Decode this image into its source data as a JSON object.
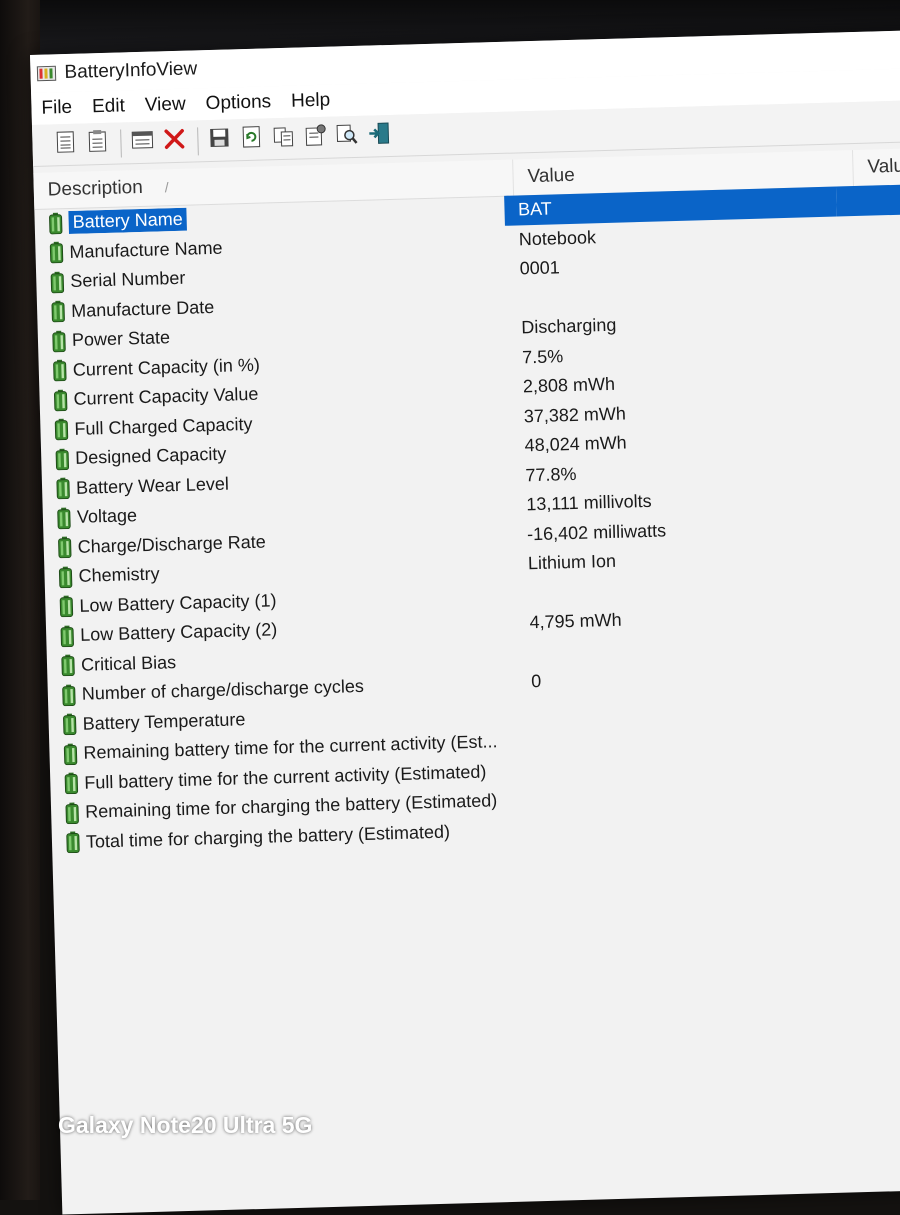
{
  "window": {
    "title": "BatteryInfoView",
    "app_icon": "battery-app-icon"
  },
  "menu": [
    "File",
    "Edit",
    "View",
    "Options",
    "Help"
  ],
  "toolbar": [
    {
      "icon": "html-report-icon"
    },
    {
      "icon": "report-icon"
    },
    {
      "sep": true
    },
    {
      "icon": "properties-icon"
    },
    {
      "icon": "delete-icon"
    },
    {
      "sep": true
    },
    {
      "icon": "save-icon"
    },
    {
      "icon": "refresh-icon"
    },
    {
      "icon": "copy-icon"
    },
    {
      "icon": "options-icon"
    },
    {
      "icon": "find-icon"
    },
    {
      "icon": "exit-icon"
    }
  ],
  "columns": {
    "description": "Description",
    "value": "Value",
    "value2": "Valu"
  },
  "rows": [
    {
      "description": "Battery Name",
      "value": "BAT",
      "selected": true
    },
    {
      "description": "Manufacture Name",
      "value": "Notebook"
    },
    {
      "description": "Serial Number",
      "value": "0001"
    },
    {
      "description": "Manufacture Date",
      "value": ""
    },
    {
      "description": "Power State",
      "value": "Discharging"
    },
    {
      "description": "Current Capacity (in %)",
      "value": "7.5%"
    },
    {
      "description": "Current Capacity Value",
      "value": "2,808 mWh"
    },
    {
      "description": "Full Charged Capacity",
      "value": "37,382 mWh"
    },
    {
      "description": "Designed Capacity",
      "value": "48,024 mWh"
    },
    {
      "description": "Battery Wear Level",
      "value": "77.8%"
    },
    {
      "description": "Voltage",
      "value": "13,111 millivolts"
    },
    {
      "description": "Charge/Discharge Rate",
      "value": "-16,402 milliwatts"
    },
    {
      "description": "Chemistry",
      "value": "Lithium Ion"
    },
    {
      "description": "Low Battery Capacity (1)",
      "value": ""
    },
    {
      "description": "Low Battery Capacity (2)",
      "value": "4,795 mWh"
    },
    {
      "description": "Critical Bias",
      "value": ""
    },
    {
      "description": "Number of charge/discharge cycles",
      "value": "0"
    },
    {
      "description": "Battery Temperature",
      "value": ""
    },
    {
      "description": "Remaining battery time for the current activity (Est...",
      "value": ""
    },
    {
      "description": "Full battery time for the current activity (Estimated)",
      "value": ""
    },
    {
      "description": "Remaining time for charging the battery (Estimated)",
      "value": ""
    },
    {
      "description": "Total  time for charging the battery (Estimated)",
      "value": ""
    }
  ],
  "overlay": {
    "camera_watermark": "Galaxy Note20 Ultra 5G"
  },
  "colors": {
    "selection": "#0a64c8",
    "battery_icon": "#3a8a2e"
  }
}
